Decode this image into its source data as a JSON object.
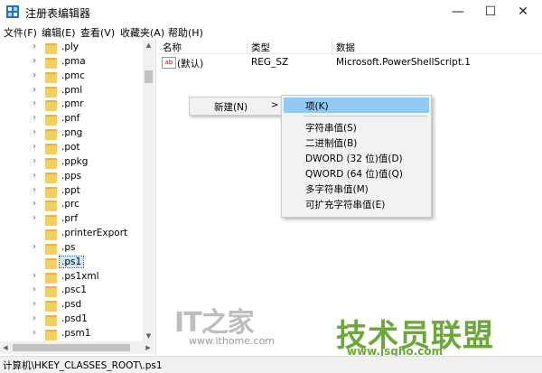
{
  "window": {
    "title": "注册表编辑器",
    "icon": "regedit-icon",
    "controls": {
      "minimize": "—",
      "maximize": "☐",
      "close": "✕"
    }
  },
  "menu": [
    "文件(F)",
    "编辑(E)",
    "查看(V)",
    "收藏夹(A)",
    "帮助(H)"
  ],
  "tree": {
    "items": [
      ".ply",
      ".pma",
      ".pmc",
      ".pml",
      ".pmr",
      ".pnf",
      ".png",
      ".pot",
      ".ppkg",
      ".pps",
      ".ppt",
      ".prc",
      ".prf",
      ".printerExport",
      ".ps",
      ".ps1",
      ".ps1xml",
      ".psc1",
      ".psd",
      ".psd1",
      ".psm1"
    ],
    "expandable": [
      true,
      true,
      true,
      true,
      true,
      true,
      true,
      true,
      true,
      true,
      true,
      true,
      true,
      false,
      true,
      false,
      true,
      true,
      true,
      true,
      true
    ],
    "selected_index": 15
  },
  "list": {
    "columns": [
      "名称",
      "类型",
      "数据"
    ],
    "rows": [
      {
        "icon": "ab",
        "name": "(默认)",
        "type": "REG_SZ",
        "data": "Microsoft.PowerShellScript.1"
      }
    ]
  },
  "context_menu": {
    "new_label": "新建(N)",
    "new_arrow": ">",
    "submenu": [
      "项(K)",
      "字符串值(S)",
      "二进制值(B)",
      "DWORD (32 位)值(D)",
      "QWORD (64 位)值(Q)",
      "多字符串值(M)",
      "可扩充字符串值(E)"
    ],
    "highlighted_index": 0
  },
  "status": {
    "path": "计算机\\HKEY_CLASSES_ROOT\\.ps1"
  },
  "watermarks": {
    "ithome_logo": "IT之家",
    "ithome_site": "www.ithome.com",
    "jsgho_logo": "技术员联盟",
    "jsgho_site": "www.jsgho.com"
  },
  "colors": {
    "selection": "#91c9f7",
    "folder": "#f5cf62",
    "jsgho_green": "#6aa837"
  }
}
